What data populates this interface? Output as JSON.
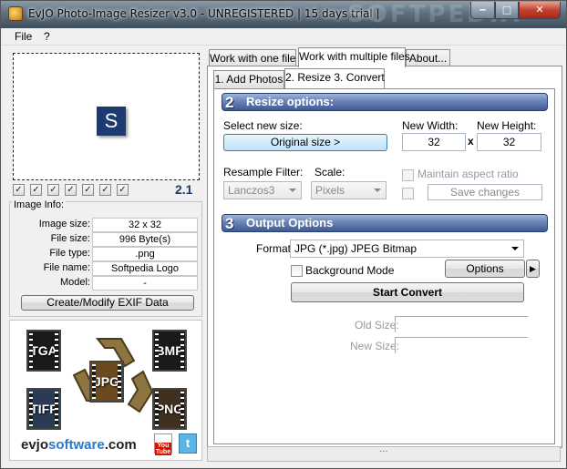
{
  "window": {
    "title": "EvJO Photo-Image Resizer v3.0 - UNREGISTERED  | 15 days trial |",
    "watermark": "SOFTPEDIA",
    "min": "‒",
    "max": "□",
    "close": "✕"
  },
  "menu": {
    "items": [
      "File",
      "?"
    ]
  },
  "preview": {
    "logo_letter": "S",
    "version": "2.1"
  },
  "image_info": {
    "legend": "Image Info:",
    "rows": [
      {
        "label": "Image size:",
        "value": "32 x 32"
      },
      {
        "label": "File size:",
        "value": "996 Byte(s)"
      },
      {
        "label": "File type:",
        "value": ".png"
      },
      {
        "label": "File name:",
        "value": "Softpedia Logo"
      },
      {
        "label": "Model:",
        "value": "-"
      }
    ],
    "exif_button": "Create/Modify EXIF Data"
  },
  "promo": {
    "formats": [
      "TGA",
      "BMP",
      "JPG",
      "TIFF",
      "PNG"
    ],
    "site_a": "evjo",
    "site_b": "software",
    "site_c": ".com",
    "youtube": "You Tube",
    "twitter": "t"
  },
  "tabs": {
    "main": [
      "Work with one file",
      "Work with multiple files",
      "About..."
    ],
    "sub": [
      "1. Add Photos",
      "2. Resize 3. Convert"
    ]
  },
  "resize": {
    "heading_num": "2",
    "heading": "Resize options:",
    "select_label": "Select new size:",
    "size_button": "Original size >",
    "width_label": "New Width:",
    "height_label": "New Height:",
    "width": "32",
    "height": "32",
    "times": "x",
    "filter_label": "Resample Filter:",
    "filter_value": "Lanczos3",
    "scale_label": "Scale:",
    "scale_value": "Pixels",
    "aspect_label": "Maintain aspect ratio",
    "save_changes": "Save changes"
  },
  "output": {
    "heading_num": "3",
    "heading": "Output Options",
    "format_label": "Format:",
    "format_value": "JPG (*.jpg) JPEG Bitmap",
    "background_label": "Background Mode",
    "options_button": "Options",
    "more_button": "▶",
    "start_button": "Start Convert",
    "old_size_label": "Old Size:",
    "new_size_label": "New Size:"
  },
  "status": {
    "grip": "..."
  }
}
